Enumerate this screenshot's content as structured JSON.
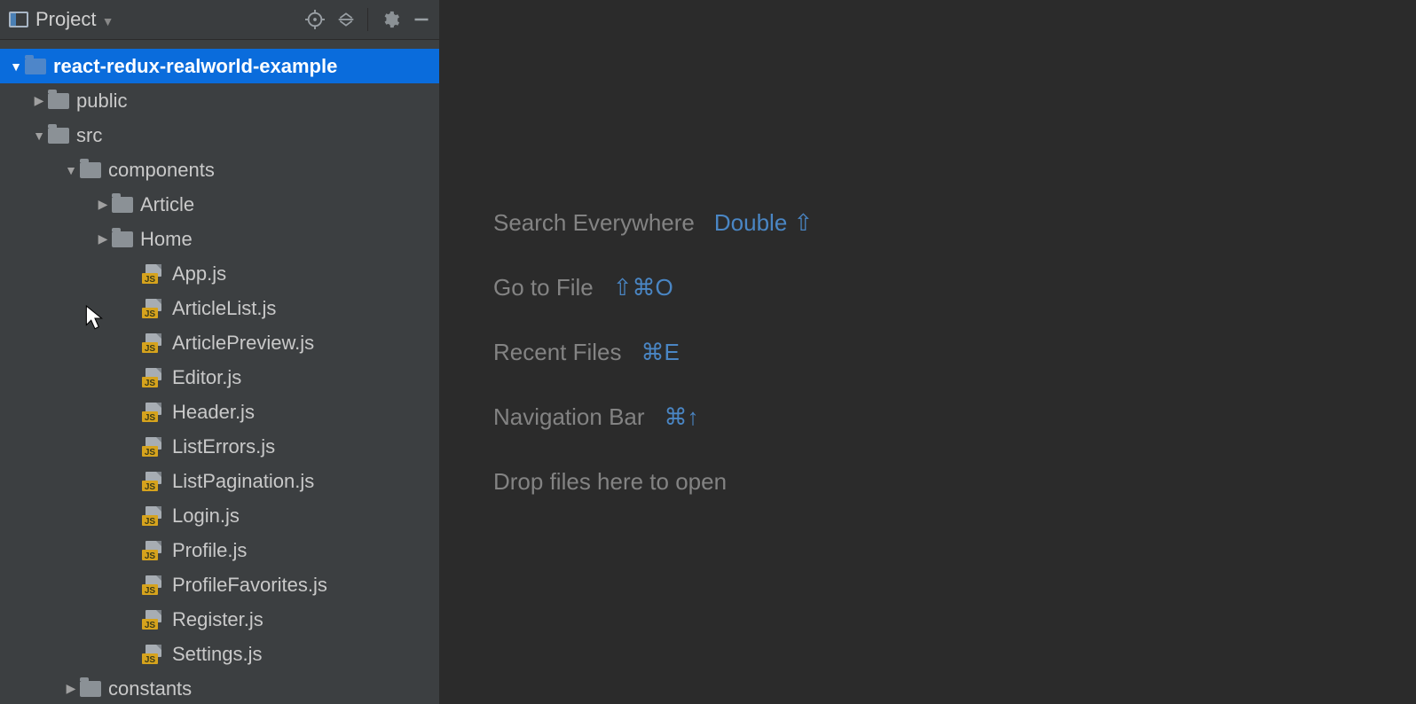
{
  "header": {
    "title": "Project"
  },
  "tree": [
    {
      "depthClass": "depth-0",
      "arrow": "down",
      "icon": "folder",
      "label": "react-redux-realworld-example",
      "selected": true
    },
    {
      "depthClass": "depth-1",
      "arrow": "right",
      "icon": "folder",
      "label": "public"
    },
    {
      "depthClass": "depth-1",
      "arrow": "down",
      "icon": "folder",
      "label": "src"
    },
    {
      "depthClass": "depth-2",
      "arrow": "down",
      "icon": "folder",
      "label": "components"
    },
    {
      "depthClass": "depth-3",
      "arrow": "right",
      "icon": "folder",
      "label": "Article"
    },
    {
      "depthClass": "depth-3",
      "arrow": "right",
      "icon": "folder",
      "label": "Home"
    },
    {
      "depthClass": "depth-3f",
      "arrow": "none",
      "icon": "js",
      "label": "App.js"
    },
    {
      "depthClass": "depth-3f",
      "arrow": "none",
      "icon": "js",
      "label": "ArticleList.js"
    },
    {
      "depthClass": "depth-3f",
      "arrow": "none",
      "icon": "js",
      "label": "ArticlePreview.js"
    },
    {
      "depthClass": "depth-3f",
      "arrow": "none",
      "icon": "js",
      "label": "Editor.js"
    },
    {
      "depthClass": "depth-3f",
      "arrow": "none",
      "icon": "js",
      "label": "Header.js"
    },
    {
      "depthClass": "depth-3f",
      "arrow": "none",
      "icon": "js",
      "label": "ListErrors.js"
    },
    {
      "depthClass": "depth-3f",
      "arrow": "none",
      "icon": "js",
      "label": "ListPagination.js"
    },
    {
      "depthClass": "depth-3f",
      "arrow": "none",
      "icon": "js",
      "label": "Login.js"
    },
    {
      "depthClass": "depth-3f",
      "arrow": "none",
      "icon": "js",
      "label": "Profile.js"
    },
    {
      "depthClass": "depth-3f",
      "arrow": "none",
      "icon": "js",
      "label": "ProfileFavorites.js"
    },
    {
      "depthClass": "depth-3f",
      "arrow": "none",
      "icon": "js",
      "label": "Register.js"
    },
    {
      "depthClass": "depth-3f",
      "arrow": "none",
      "icon": "js",
      "label": "Settings.js"
    },
    {
      "depthClass": "depth-2",
      "arrow": "right",
      "icon": "folder",
      "label": "constants"
    }
  ],
  "hints": [
    {
      "label": "Search Everywhere",
      "shortcut": "Double ⇧"
    },
    {
      "label": "Go to File",
      "shortcut": "⇧⌘O"
    },
    {
      "label": "Recent Files",
      "shortcut": "⌘E"
    },
    {
      "label": "Navigation Bar",
      "shortcut": "⌘↑"
    },
    {
      "label": "Drop files here to open",
      "shortcut": ""
    }
  ]
}
